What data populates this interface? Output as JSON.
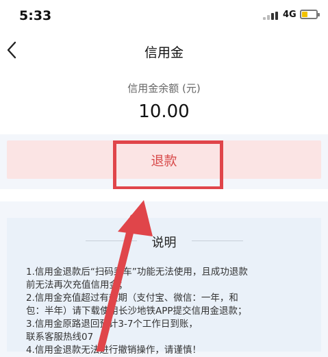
{
  "status_bar": {
    "time": "5:33",
    "network": "4G"
  },
  "nav": {
    "title": "信用金"
  },
  "balance": {
    "label": "信用金余额 (元)",
    "value": "10.00"
  },
  "refund": {
    "label": "退款"
  },
  "info": {
    "title": "说明",
    "lines": [
      "1.信用金退款后“扫码乘车”功能无法使用，且成功退款",
      "前无法再次充值信用金；",
      "2.信用金充值超过有效期（支付宝、微信：一年，和",
      "包：半年）请下载使用长沙地铁APP提交信用金退款；",
      "3.信用金原路退回预计3-7个工作日到账，",
      "联系客服热线07",
      "4.信用金退款无法进行撤销操作，请谨慎！"
    ]
  },
  "colors": {
    "accent_red": "#e0454a",
    "refund_text": "#d84a4a",
    "battery": "#f2c200"
  }
}
